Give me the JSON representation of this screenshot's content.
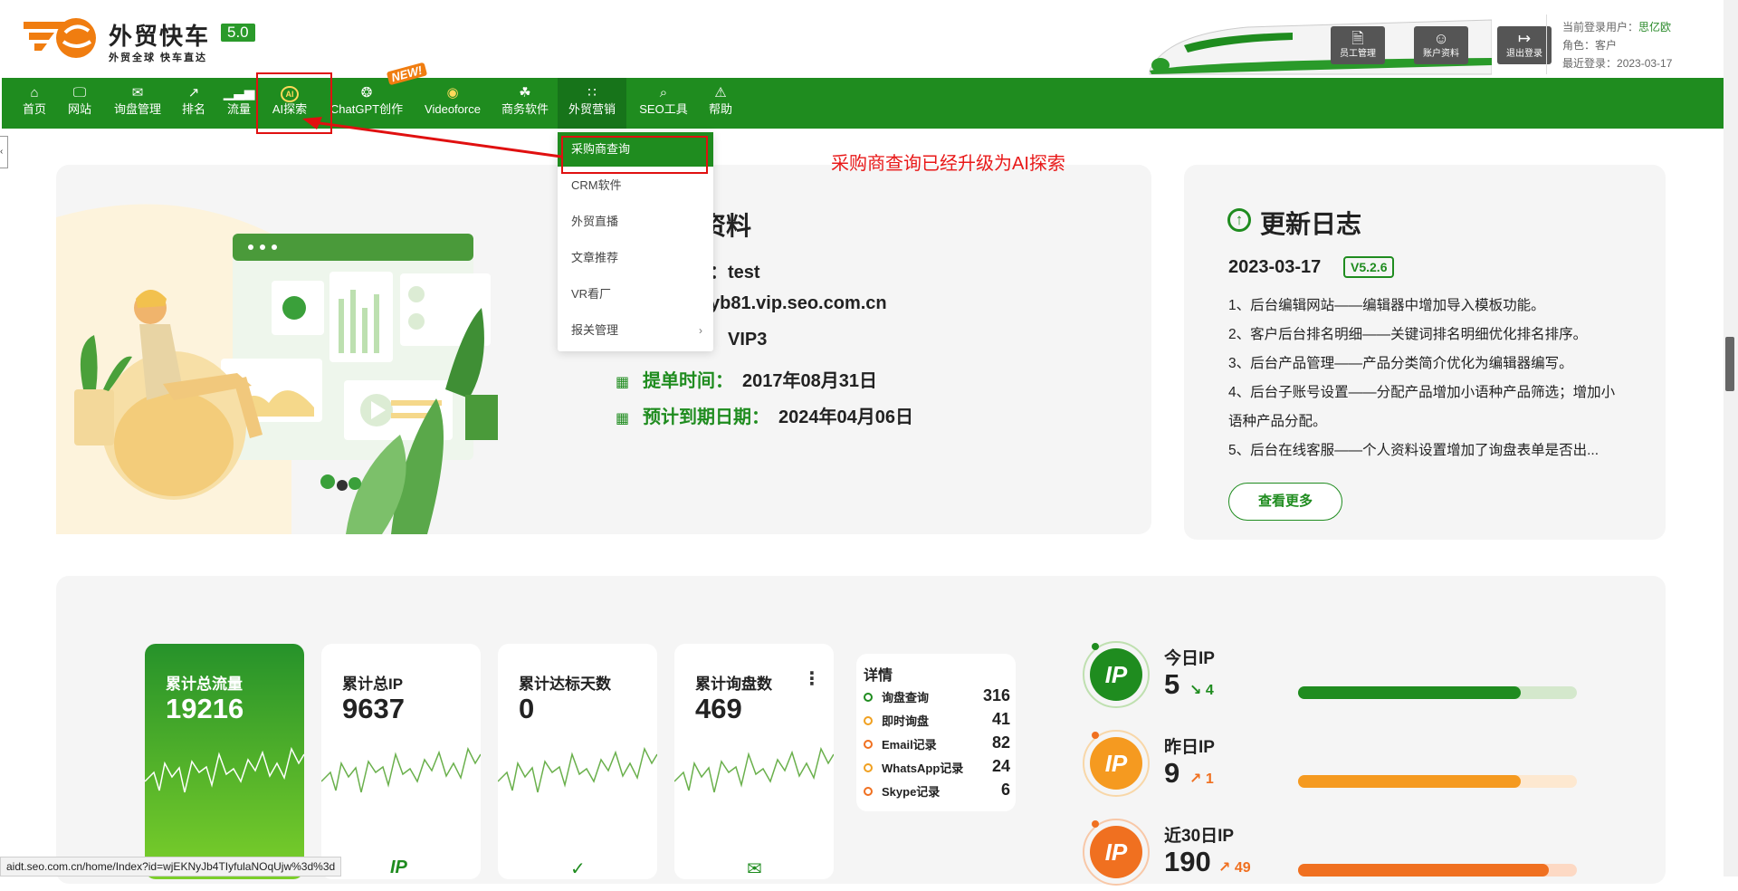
{
  "header": {
    "logo_title": "外贸快车",
    "logo_version": "5.0",
    "logo_subtitle": "外贸全球 快车直达",
    "buttons": [
      {
        "label": "员工管理",
        "icon": "staff-icon"
      },
      {
        "label": "账户资料",
        "icon": "account-icon"
      },
      {
        "label": "退出登录",
        "icon": "logout-icon"
      }
    ],
    "user": {
      "current_user_label": "当前登录用户：",
      "current_user": "思亿欧",
      "role_label": "角色：",
      "role": "客户",
      "last_login_label": "最近登录：",
      "last_login": "2023-03-17"
    }
  },
  "nav": {
    "items": [
      {
        "label": "首页",
        "icon": "home-icon"
      },
      {
        "label": "网站",
        "icon": "monitor-icon"
      },
      {
        "label": "询盘管理",
        "icon": "mail-icon"
      },
      {
        "label": "排名",
        "icon": "rank-icon"
      },
      {
        "label": "流量",
        "icon": "chart-icon"
      },
      {
        "label": "AI探索",
        "icon": "ai-icon"
      },
      {
        "label": "ChatGPT创作",
        "icon": "chatgpt-icon"
      },
      {
        "label": "Videoforce",
        "icon": "video-icon"
      },
      {
        "label": "商务软件",
        "icon": "business-icon"
      },
      {
        "label": "外贸营销",
        "icon": "apps-icon"
      },
      {
        "label": "SEO工具",
        "icon": "search-icon"
      },
      {
        "label": "帮助",
        "icon": "warning-icon"
      }
    ],
    "new_badge": "NEW!"
  },
  "dropdown": {
    "items": [
      "采购商查询",
      "CRM软件",
      "外贸直播",
      "文章推荐",
      "VR看厂",
      "报关管理"
    ]
  },
  "annotation": "采购商查询已经升级为AI探索",
  "profile": {
    "title_partial": "资料",
    "account_value": "：test",
    "domain_partial": "yb81.vip.seo.com.cn",
    "level_value": "VIP3",
    "submit_label": "提单时间：",
    "submit_date": "2017年08月31日",
    "expire_label": "预计到期日期：",
    "expire_date": "2024年04月06日"
  },
  "changelog": {
    "title": "更新日志",
    "date": "2023-03-17",
    "version": "V5.2.6",
    "lines": [
      "1、后台编辑网站——编辑器中增加导入模板功能。",
      "2、客户后台排名明细——关键词排名明细优化排名排序。",
      "3、后台产品管理——产品分类简介优化为编辑器编写。",
      "4、后台子账号设置——分配产品增加小语种产品筛选；增加小语种产品分配。",
      "5、后台在线客服——个人资料设置增加了询盘表单是否出..."
    ],
    "more_button": "查看更多"
  },
  "stats": {
    "cards": [
      {
        "title": "累计总流量",
        "value": "19216"
      },
      {
        "title": "累计总IP",
        "value": "9637"
      },
      {
        "title": "累计达标天数",
        "value": "0"
      },
      {
        "title": "累计询盘数",
        "value": "469"
      }
    ],
    "details": {
      "title": "详情",
      "rows": [
        {
          "label": "询盘查询",
          "value": "316",
          "color": "#1f8c1f"
        },
        {
          "label": "即时询盘",
          "value": "41",
          "color": "#f0a020"
        },
        {
          "label": "Email记录",
          "value": "82",
          "color": "#f07020"
        },
        {
          "label": "WhatsApp记录",
          "value": "24",
          "color": "#f0a020"
        },
        {
          "label": "Skype记录",
          "value": "6",
          "color": "#f07020"
        }
      ]
    },
    "ip": [
      {
        "label": "今日IP",
        "value": "5",
        "delta": "4",
        "progress": 0.8,
        "color": "#1f8c1f"
      },
      {
        "label": "昨日IP",
        "value": "9",
        "delta": "1",
        "progress": 0.8,
        "color": "#f59a20"
      },
      {
        "label": "近30日IP",
        "value": "190",
        "delta": "49",
        "progress": 0.9,
        "color": "#f07020"
      }
    ]
  },
  "statusbar": "aidt.seo.com.cn/home/Index?id=wjEKNyJb4TIyfulaNOqUjw%3d%3d"
}
